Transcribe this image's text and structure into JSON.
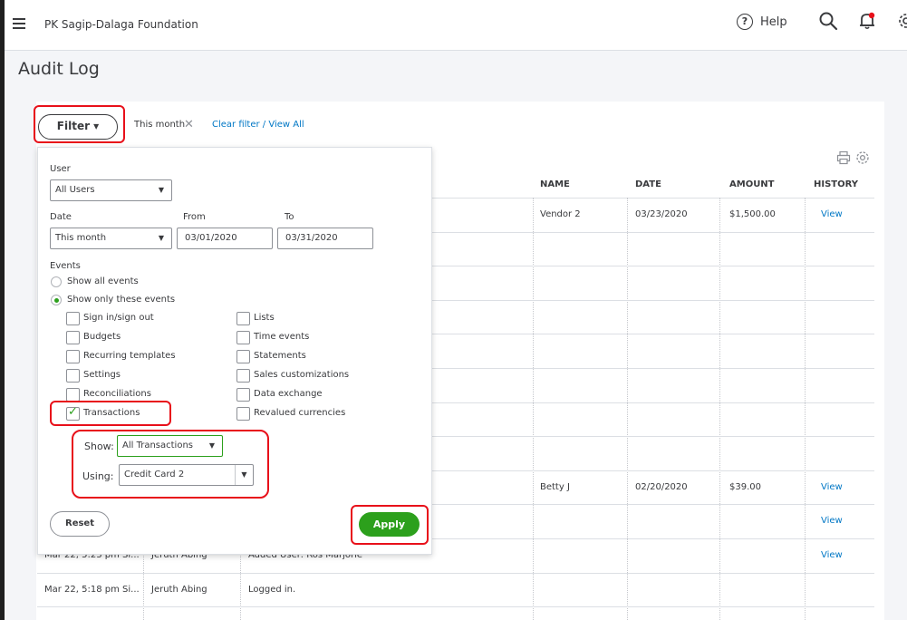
{
  "header": {
    "company_name": "PK Sagip-Dalaga Foundation",
    "help_label": "Help",
    "help_symbol": "?"
  },
  "page": {
    "title": "Audit Log"
  },
  "filter_bar": {
    "filter_label": "Filter ▾",
    "active_filter": "This month",
    "remove_symbol": "✕",
    "clear_link": "Clear filter / View All"
  },
  "table": {
    "headers": {
      "name": "NAME",
      "date": "DATE",
      "amount": "AMOUNT",
      "history": "HISTORY"
    },
    "rows": [
      {
        "date_changed": "",
        "user": "",
        "event": "",
        "name": "Vendor 2",
        "date": "03/23/2020",
        "amount": "$1,500.00",
        "history": "View"
      },
      {
        "date_changed": "",
        "user": "",
        "event": "",
        "name": "",
        "date": "",
        "amount": "",
        "history": ""
      },
      {
        "date_changed": "",
        "user": "",
        "event": "",
        "name": "",
        "date": "",
        "amount": "",
        "history": ""
      },
      {
        "date_changed": "",
        "user": "",
        "event": "",
        "name": "",
        "date": "",
        "amount": "",
        "history": ""
      },
      {
        "date_changed": "",
        "user": "",
        "event": "",
        "name": "",
        "date": "",
        "amount": "",
        "history": ""
      },
      {
        "date_changed": "",
        "user": "",
        "event": "",
        "name": "",
        "date": "",
        "amount": "",
        "history": ""
      },
      {
        "date_changed": "",
        "user": "",
        "event": "",
        "name": "",
        "date": "",
        "amount": "",
        "history": ""
      },
      {
        "date_changed": "",
        "user": "",
        "event": "",
        "name": "",
        "date": "",
        "amount": "",
        "history": ""
      },
      {
        "date_changed": "",
        "user": "",
        "event": "",
        "name": "Betty J",
        "date": "02/20/2020",
        "amount": "$39.00",
        "history": "View"
      },
      {
        "date_changed": "",
        "user": "",
        "event": "",
        "name": "",
        "date": "",
        "amount": "",
        "history": "View"
      },
      {
        "date_changed": "Mar 22, 5:23 pm Si...",
        "user": "Jeruth Abing",
        "event": "Added User: Ros Marjorie",
        "name": "",
        "date": "",
        "amount": "",
        "history": "View"
      },
      {
        "date_changed": "Mar 22, 5:18 pm Si...",
        "user": "Jeruth Abing",
        "event": "Logged in.",
        "name": "",
        "date": "",
        "amount": "",
        "history": ""
      }
    ]
  },
  "filter_panel": {
    "user_label": "User",
    "user_value": "All Users",
    "date_label": "Date",
    "date_value": "This month",
    "from_label": "From",
    "from_value": "03/01/2020",
    "to_label": "To",
    "to_value": "03/31/2020",
    "events_label": "Events",
    "radio_all": "Show all events",
    "radio_only": "Show only these events",
    "checkboxes_left": [
      {
        "label": "Sign in/sign out",
        "checked": false
      },
      {
        "label": "Budgets",
        "checked": false
      },
      {
        "label": "Recurring templates",
        "checked": false
      },
      {
        "label": "Settings",
        "checked": false
      },
      {
        "label": "Reconciliations",
        "checked": false
      },
      {
        "label": "Transactions",
        "checked": true
      }
    ],
    "checkboxes_right": [
      {
        "label": "Lists",
        "checked": false
      },
      {
        "label": "Time events",
        "checked": false
      },
      {
        "label": "Statements",
        "checked": false
      },
      {
        "label": "Sales customizations",
        "checked": false
      },
      {
        "label": "Data exchange",
        "checked": false
      },
      {
        "label": "Revalued currencies",
        "checked": false
      }
    ],
    "show_label": "Show:",
    "show_value": "All Transactions",
    "using_label": "Using:",
    "using_value": "Credit Card 2",
    "reset_label": "Reset",
    "apply_label": "Apply"
  },
  "colors": {
    "accent_green": "#2ca01c",
    "link_blue": "#0077c5",
    "highlight_red": "#e8101a",
    "text": "#393a3d"
  }
}
